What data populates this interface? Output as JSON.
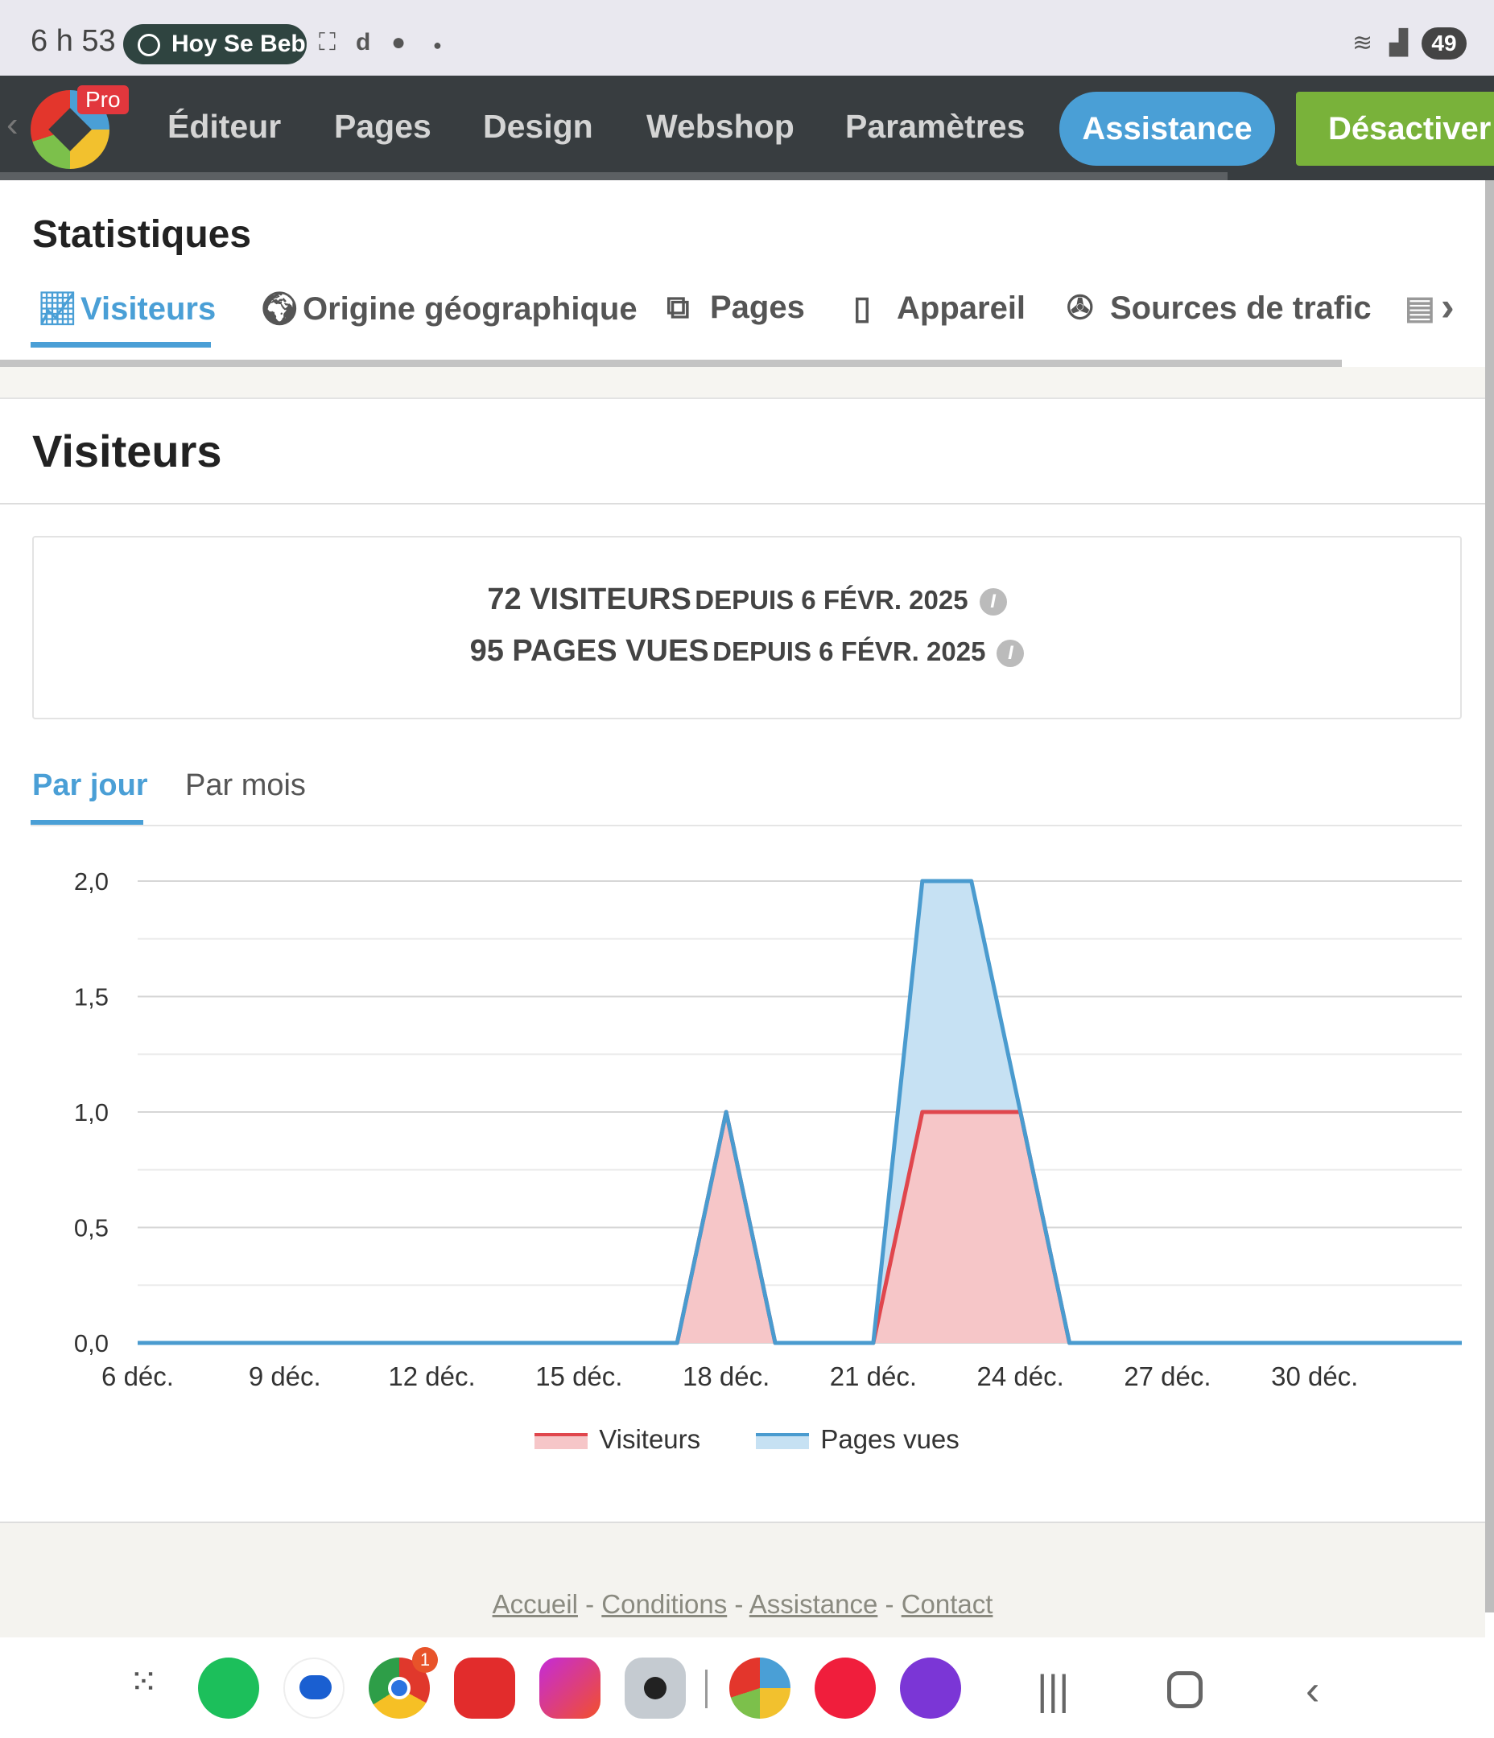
{
  "status_bar": {
    "time": "6 h 53",
    "media_pill": "Hoy Se Bebe",
    "battery": "49"
  },
  "nav": {
    "logo_badge": "Pro",
    "items": [
      "Éditeur",
      "Pages",
      "Design",
      "Webshop",
      "Paramètres"
    ],
    "assistance": "Assistance",
    "deactivate": "Désactiver"
  },
  "page_title": "Statistiques",
  "tabs": [
    {
      "label": "Visiteurs",
      "icon": "line-chart-icon",
      "active": true
    },
    {
      "label": "Origine géographique",
      "icon": "globe-icon"
    },
    {
      "label": "Pages",
      "icon": "pages-icon"
    },
    {
      "label": "Appareil",
      "icon": "mobile-icon"
    },
    {
      "label": "Sources de trafic",
      "icon": "traffic-icon"
    }
  ],
  "section_title": "Visiteurs",
  "summary": {
    "visitors_count": "72 visiteurs",
    "visitors_since": "depuis 6 févr. 2025",
    "pages_count": "95 pages vues",
    "pages_since": "depuis 6 févr. 2025"
  },
  "period_tabs": {
    "day": "Par jour",
    "month": "Par mois",
    "active": "day"
  },
  "chart_data": {
    "type": "area",
    "x": [
      "6 déc.",
      "7 déc.",
      "8 déc.",
      "9 déc.",
      "10 déc.",
      "11 déc.",
      "12 déc.",
      "13 déc.",
      "14 déc.",
      "15 déc.",
      "16 déc.",
      "17 déc.",
      "18 déc.",
      "19 déc.",
      "20 déc.",
      "21 déc.",
      "22 déc.",
      "23 déc.",
      "24 déc.",
      "25 déc.",
      "26 déc.",
      "27 déc.",
      "28 déc.",
      "29 déc.",
      "30 déc.",
      "31 déc.",
      "1 janv.",
      "2 janv."
    ],
    "x_ticks": [
      "6 déc.",
      "9 déc.",
      "12 déc.",
      "15 déc.",
      "18 déc.",
      "21 déc.",
      "24 déc.",
      "27 déc.",
      "30 déc."
    ],
    "y_ticks": [
      "0,0",
      "0,5",
      "1,0",
      "1,5",
      "2,0"
    ],
    "ylim": [
      0,
      2
    ],
    "grid": true,
    "legend": "bottom",
    "series": [
      {
        "name": "Visiteurs",
        "color": "#e0464d",
        "fill": "#f6c6c8",
        "values": [
          0,
          0,
          0,
          0,
          0,
          0,
          0,
          0,
          0,
          0,
          0,
          0,
          1,
          0,
          0,
          0,
          1,
          1,
          1,
          0,
          0,
          0,
          0,
          0,
          0,
          0,
          0,
          0
        ]
      },
      {
        "name": "Pages vues",
        "color": "#4a9bcf",
        "fill": "#c6e1f3",
        "values": [
          0,
          0,
          0,
          0,
          0,
          0,
          0,
          0,
          0,
          0,
          0,
          0,
          1,
          0,
          0,
          0,
          2,
          2,
          1,
          0,
          0,
          0,
          0,
          0,
          0,
          0,
          0,
          0
        ]
      }
    ]
  },
  "footer": {
    "links": [
      "Accueil",
      "Conditions",
      "Assistance",
      "Contact"
    ],
    "separator": "-"
  },
  "dock": {
    "chrome_badge": "1"
  }
}
